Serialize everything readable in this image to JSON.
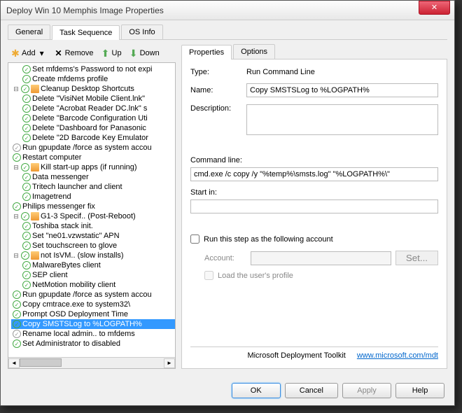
{
  "window": {
    "title": "Deploy Win 10 Memphis Image Properties"
  },
  "mainTabs": {
    "t0": "General",
    "t1": "Task Sequence",
    "t2": "OS Info",
    "active": 1
  },
  "toolbar": {
    "add": "Add",
    "remove": "Remove",
    "up": "Up",
    "down": "Down"
  },
  "tree": {
    "n0": "Set mfdems's Password to not expi",
    "n1": "Create mfdems profile",
    "g0": "Cleanup Desktop Shortcuts",
    "n2": "Delete \"VisiNet Mobile Client.lnk\"",
    "n3": "Delete \"Acrobat Reader DC.lnk\" s",
    "n4": "Delete \"Barcode Configuration Uti",
    "n5": "Delete \"Dashboard for Panasonic",
    "n6": "Delete \"2D Barcode Key Emulator",
    "n7": "Run gpupdate /force as system accou",
    "n8": "Restart computer",
    "g1": "Kill start-up apps (if running)",
    "n9": "Data messenger",
    "n10": "Tritech launcher and client",
    "n11": "Imagetrend",
    "n12": "Philips messenger fix",
    "g2": "G1-3 Specif.. (Post-Reboot)",
    "n13": "Toshiba stack init.",
    "n14": "Set \"ne01.vzwstatic\" APN",
    "n15": "Set touchscreen to glove",
    "g3": "not IsVM.. (slow installs)",
    "n16": "MalwareBytes client",
    "n17": "SEP client",
    "n18": "NetMotion mobility client",
    "n19": "Run gpupdate /force as system accou",
    "n20": "Copy cmtrace.exe to system32\\",
    "n21": "Prompt OSD Deployment Time",
    "n22": "Copy SMSTSLog to %LOGPATH%",
    "n23": "Rename local admin.. to mfdems",
    "n24": "Set Administrator to disabled"
  },
  "propsTabs": {
    "p0": "Properties",
    "p1": "Options"
  },
  "props": {
    "typeLabel": "Type:",
    "typeValue": "Run Command Line",
    "nameLabel": "Name:",
    "nameValue": "Copy SMSTSLog to %LOGPATH%",
    "descLabel": "Description:",
    "descValue": "",
    "cmdLabel": "Command line:",
    "cmdValue": "cmd.exe /c copy /y \"%temp%\\smsts.log\" \"%LOGPATH%\\\"",
    "startLabel": "Start in:",
    "startValue": "",
    "runAsLabel": "Run this step as the following account",
    "accountLabel": "Account:",
    "setBtn": "Set...",
    "loadProfileLabel": "Load the user's profile"
  },
  "footer": {
    "brand": "Microsoft Deployment Toolkit",
    "link": "www.microsoft.com/mdt"
  },
  "buttons": {
    "ok": "OK",
    "cancel": "Cancel",
    "apply": "Apply",
    "help": "Help"
  }
}
